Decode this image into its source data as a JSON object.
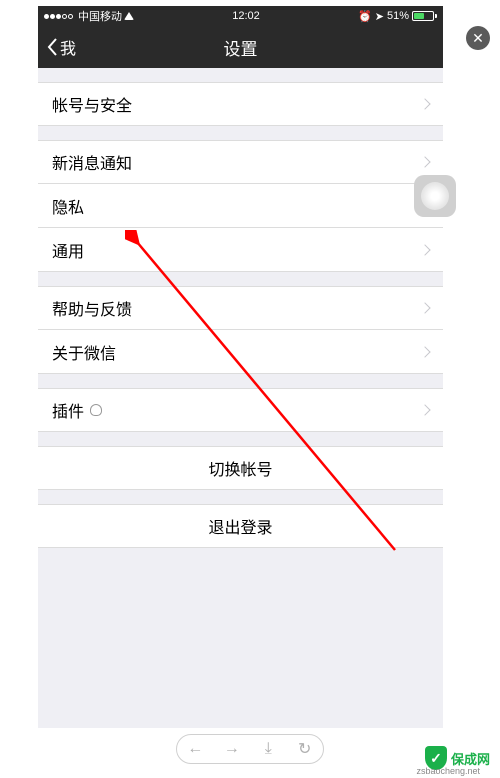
{
  "status": {
    "carrier": "中国移动",
    "time": "12:02",
    "battery_pct": "51%"
  },
  "nav": {
    "back_label": "我",
    "title": "设置"
  },
  "groups": [
    {
      "items": [
        {
          "label": "帐号与安全",
          "name": "account-security"
        }
      ]
    },
    {
      "items": [
        {
          "label": "新消息通知",
          "name": "notifications"
        },
        {
          "label": "隐私",
          "name": "privacy"
        },
        {
          "label": "通用",
          "name": "general"
        }
      ]
    },
    {
      "items": [
        {
          "label": "帮助与反馈",
          "name": "help-feedback"
        },
        {
          "label": "关于微信",
          "name": "about-wechat"
        }
      ]
    },
    {
      "items": [
        {
          "label": "插件",
          "name": "plugins",
          "has_bulb": true
        }
      ]
    }
  ],
  "actions": {
    "switch_account": "切换帐号",
    "logout": "退出登录"
  },
  "watermark": {
    "brand": "保成网",
    "url": "zsbaocheng.net"
  }
}
